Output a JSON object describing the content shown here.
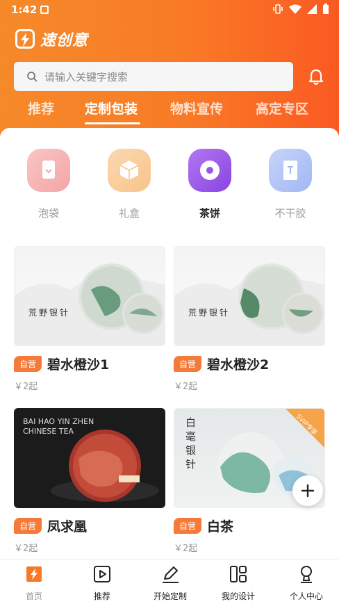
{
  "status_bar": {
    "time": "1:42"
  },
  "header": {
    "logo_text": "速创意",
    "search_placeholder": "请输入关键字搜索"
  },
  "tabs": [
    {
      "label": "推荐",
      "active": false
    },
    {
      "label": "定制包装",
      "active": true
    },
    {
      "label": "物料宣传",
      "active": false
    },
    {
      "label": "高定专区",
      "active": false
    }
  ],
  "categories": [
    {
      "label": "泡袋",
      "icon": "pouch-icon",
      "color": "#f4a3a3",
      "active": false
    },
    {
      "label": "礼盒",
      "icon": "gift-box-icon",
      "color": "#f8c68f",
      "active": false
    },
    {
      "label": "茶饼",
      "icon": "tea-cake-icon",
      "color": "#9a58e8",
      "active": true
    },
    {
      "label": "不干胶",
      "icon": "sticker-icon",
      "color": "#a9bdf6",
      "active": false
    }
  ],
  "products": [
    {
      "badge": "自营",
      "title": "碧水橙沙1",
      "price": "￥2起",
      "image_text": "荒野银针"
    },
    {
      "badge": "自营",
      "title": "碧水橙沙2",
      "price": "￥2起",
      "image_text": "荒野银针"
    },
    {
      "badge": "自营",
      "title": "凤求凰",
      "price": "￥2起",
      "image_text": "BAI HAO YIN ZHEN CHINESE TEA"
    },
    {
      "badge": "自营",
      "title": "白茶",
      "price": "￥2起",
      "image_text": "白毫银针",
      "corner_tag": "SVIP专享"
    }
  ],
  "bottom_nav": [
    {
      "label": "首页",
      "icon": "home-icon",
      "active": true
    },
    {
      "label": "推荐",
      "icon": "play-icon",
      "active": false
    },
    {
      "label": "开始定制",
      "icon": "pen-icon",
      "active": false
    },
    {
      "label": "我的设计",
      "icon": "layout-icon",
      "active": false
    },
    {
      "label": "个人中心",
      "icon": "user-icon",
      "active": false
    }
  ],
  "colors": {
    "brand_orange": "#f97a26",
    "badge_orange": "#f47a3a"
  }
}
